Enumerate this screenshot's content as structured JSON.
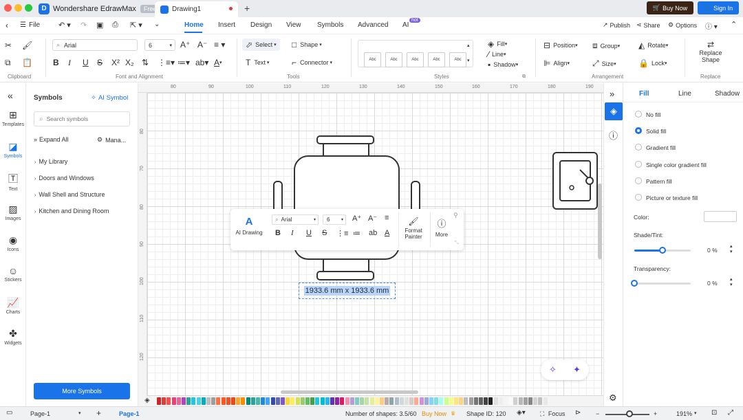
{
  "titlebar": {
    "app_name": "Wondershare EdrawMax",
    "free_badge": "Free",
    "doc_tab": "Drawing1",
    "new_tab": "+",
    "buy_now": "Buy Now",
    "sign_in": "Sign In",
    "traffic_colors": [
      "#ff5f57",
      "#febc2e",
      "#28c840"
    ]
  },
  "menubar": {
    "file": "File",
    "tabs": [
      "Home",
      "Insert",
      "Design",
      "View",
      "Symbols",
      "Advanced",
      "AI"
    ],
    "active_tab": "Home",
    "hot_badge": "hot",
    "publish": "Publish",
    "share": "Share",
    "options": "Options"
  },
  "ribbon": {
    "groups": {
      "clipboard": "Clipboard",
      "font": "Font and Alignment",
      "tools": "Tools",
      "styles": "Styles",
      "arrangement": "Arrangement",
      "replace": "Replace"
    },
    "font_name": "Arial",
    "font_size": "6",
    "select": "Select",
    "shape": "Shape",
    "text": "Text",
    "connector": "Connector",
    "style_sample": "Abc",
    "fill": "Fill",
    "line": "Line",
    "shadow": "Shadow",
    "position": "Position",
    "group": "Group",
    "rotate": "Rotate",
    "align": "Align",
    "size": "Size",
    "lock": "Lock",
    "replace_shape_1": "Replace",
    "replace_shape_2": "Shape"
  },
  "leftbar": [
    {
      "label": "Templates",
      "icon": "templates-icon"
    },
    {
      "label": "Symbols",
      "icon": "symbols-icon"
    },
    {
      "label": "Text",
      "icon": "text-icon"
    },
    {
      "label": "Images",
      "icon": "images-icon"
    },
    {
      "label": "Icons",
      "icon": "icons-icon"
    },
    {
      "label": "Stickers",
      "icon": "stickers-icon"
    },
    {
      "label": "Charts",
      "icon": "charts-icon"
    },
    {
      "label": "Widgets",
      "icon": "widgets-icon"
    }
  ],
  "symbols": {
    "title": "Symbols",
    "ai_symbol": "AI Symbol",
    "search_placeholder": "Search symbols",
    "expand_all": "Expand All",
    "manage": "Mana...",
    "items": [
      "My Library",
      "Doors and Windows",
      "Wall Shell and Structure",
      "Kitchen and Dining Room"
    ],
    "more": "More Symbols"
  },
  "canvas": {
    "ruler_top": [
      "80",
      "90",
      "100",
      "110",
      "120",
      "130",
      "140",
      "150",
      "160",
      "170",
      "180",
      "190"
    ],
    "ruler_left": [
      "80",
      "70",
      "80",
      "90",
      "100",
      "110",
      "120"
    ],
    "size_label": "1933.6 mm x 1933.6 mm"
  },
  "floatbar": {
    "ai_drawing": "AI Drawing",
    "font": "Arial",
    "size": "6",
    "format_painter_1": "Format",
    "format_painter_2": "Painter",
    "more": "More"
  },
  "rightpanel": {
    "tabs": [
      "Fill",
      "Line",
      "Shadow"
    ],
    "active_tab": "Fill",
    "options": [
      "No fill",
      "Solid fill",
      "Gradient fill",
      "Single color gradient fill",
      "Pattern fill",
      "Picture or texture fill"
    ],
    "selected_option": "Solid fill",
    "color_label": "Color:",
    "shade_label": "Shade/Tint:",
    "shade_value": "0 %",
    "shade_fraction": 0.5,
    "transparency_label": "Transparency:",
    "transparency_value": "0 %",
    "transparency_fraction": 0.0
  },
  "statusbar": {
    "page_select": "Page-1",
    "page_add": "+",
    "active_page": "Page-1",
    "shapes_count": "Number of shapes: 3.5/60",
    "buy_now": "Buy Now",
    "shape_id": "Shape ID: 120",
    "focus": "Focus",
    "zoom": "191%"
  },
  "accent": "#1a73e8"
}
